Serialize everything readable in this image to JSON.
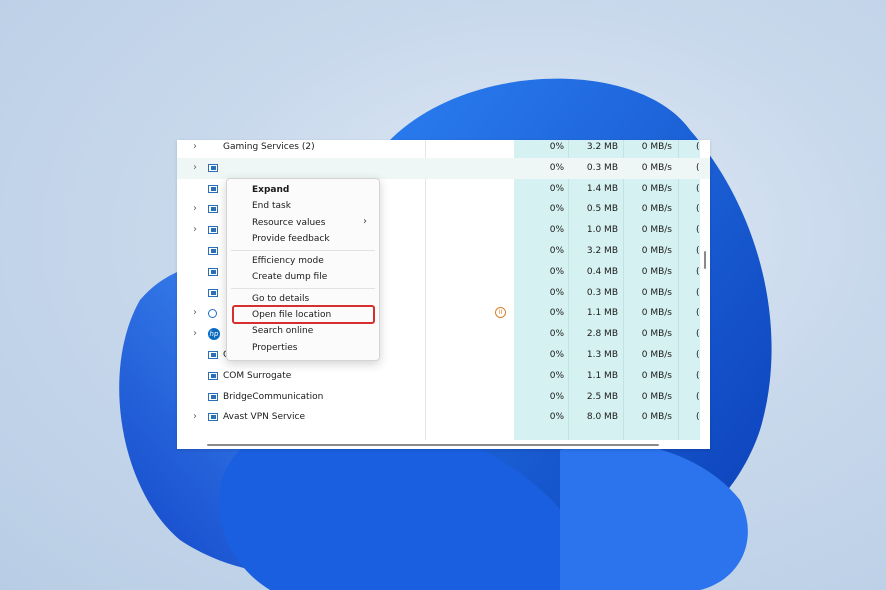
{
  "context_menu": {
    "items": [
      {
        "label": "Expand",
        "bold": true
      },
      {
        "label": "End task"
      },
      {
        "label": "Resource values",
        "submenu": true
      },
      {
        "label": "Provide feedback"
      },
      {
        "label": "Efficiency mode"
      },
      {
        "label": "Create dump file"
      },
      {
        "label": "Go to details"
      },
      {
        "label": "Open file location",
        "highlighted": true
      },
      {
        "label": "Search online"
      },
      {
        "label": "Properties"
      }
    ]
  },
  "processes": [
    {
      "name": "Gaming Services (2)",
      "expandable": true,
      "icon": "none",
      "cpu": "0%",
      "memory": "3.2 MB",
      "disk": "0 MB/s"
    },
    {
      "name": "",
      "expandable": true,
      "icon": "app-window-icon",
      "cpu": "0%",
      "memory": "0.3 MB",
      "disk": "0 MB/s"
    },
    {
      "name": "",
      "expandable": false,
      "icon": "app-window-icon",
      "cpu": "0%",
      "memory": "1.4 MB",
      "disk": "0 MB/s"
    },
    {
      "name": "",
      "expandable": true,
      "icon": "app-window-icon",
      "cpu": "0%",
      "memory": "0.5 MB",
      "disk": "0 MB/s"
    },
    {
      "name": "",
      "expandable": true,
      "icon": "app-window-icon",
      "cpu": "0%",
      "memory": "1.0 MB",
      "disk": "0 MB/s"
    },
    {
      "name": "",
      "expandable": false,
      "icon": "app-window-icon",
      "cpu": "0%",
      "memory": "3.2 MB",
      "disk": "0 MB/s"
    },
    {
      "name": "",
      "expandable": false,
      "icon": "app-window-icon",
      "cpu": "0%",
      "memory": "0.4 MB",
      "disk": "0 MB/s"
    },
    {
      "name": "",
      "expandable": false,
      "icon": "app-window-icon",
      "cpu": "0%",
      "memory": "0.3 MB",
      "disk": "0 MB/s"
    },
    {
      "name": "",
      "expandable": true,
      "icon": "circle-icon",
      "status": "paused",
      "cpu": "0%",
      "memory": "1.1 MB",
      "disk": "0 MB/s"
    },
    {
      "name": "",
      "expandable": true,
      "icon": "hp-icon",
      "cpu": "0%",
      "memory": "2.8 MB",
      "disk": "0 MB/s"
    },
    {
      "name": "COM Surrogate",
      "expandable": false,
      "icon": "app-window-icon",
      "cpu": "0%",
      "memory": "1.3 MB",
      "disk": "0 MB/s"
    },
    {
      "name": "COM Surrogate",
      "expandable": false,
      "icon": "app-window-icon",
      "cpu": "0%",
      "memory": "1.1 MB",
      "disk": "0 MB/s"
    },
    {
      "name": "BridgeCommunication",
      "expandable": false,
      "icon": "app-window-icon",
      "cpu": "0%",
      "memory": "2.5 MB",
      "disk": "0 MB/s"
    },
    {
      "name": "Avast VPN Service",
      "expandable": true,
      "icon": "app-window-icon",
      "cpu": "0%",
      "memory": "8.0 MB",
      "disk": "0 MB/s"
    }
  ],
  "glyphs": {
    "chevron": "›",
    "submenu_arrow": "›",
    "paused": "II",
    "hp": "hp",
    "net_partial": "("
  },
  "colors": {
    "cpu_highlight": "#d6f1f1",
    "menu_highlight_border": "#d62f2f",
    "wallpaper_blue": "#1a5fe0"
  }
}
